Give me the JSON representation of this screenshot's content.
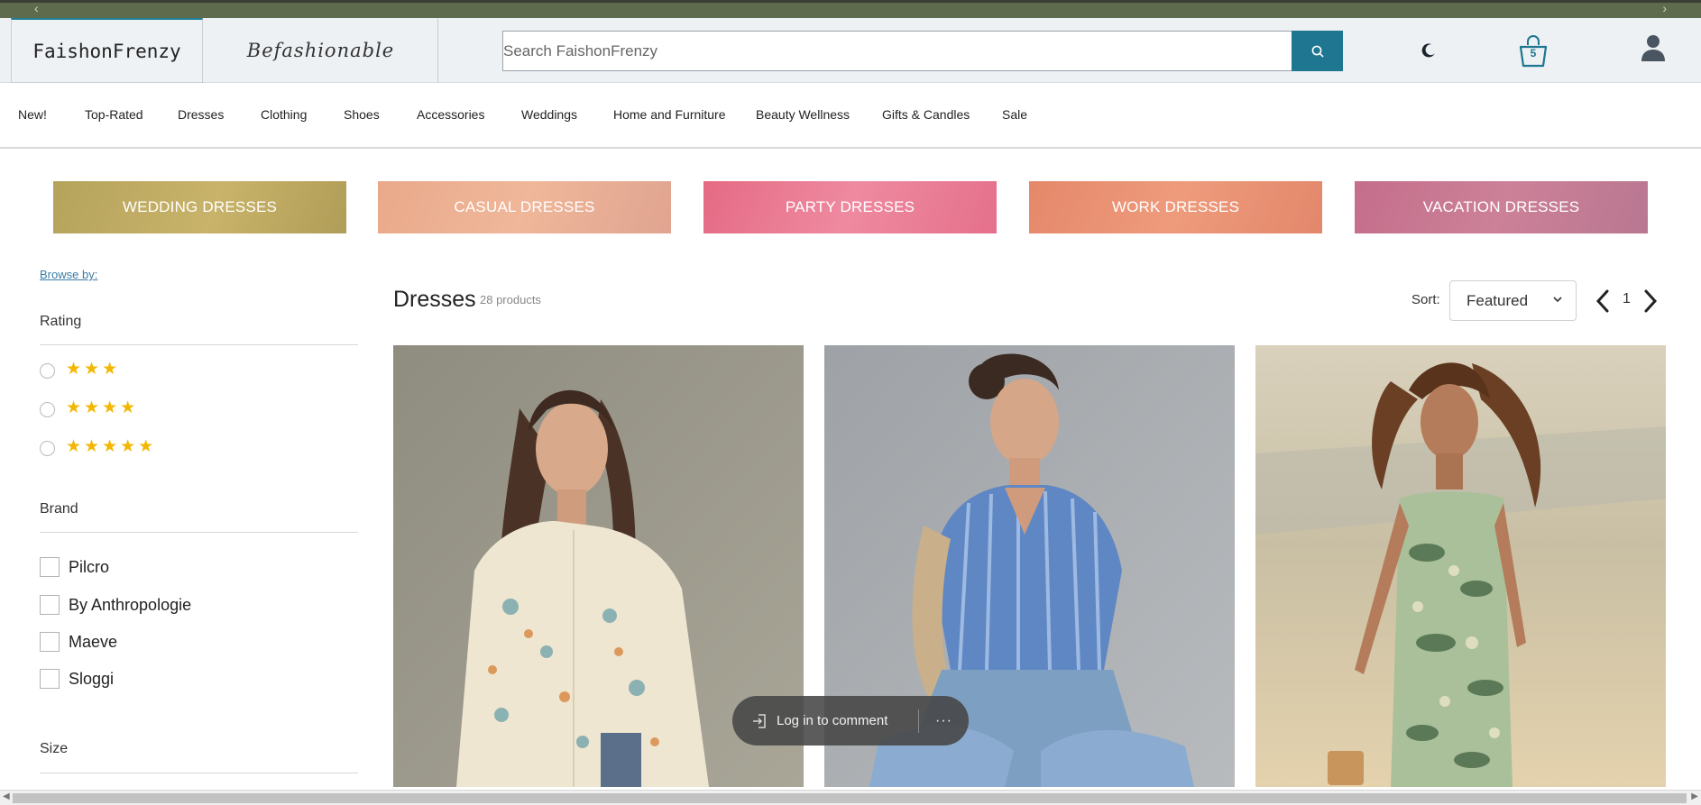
{
  "header": {
    "brand_active": "FaishonFrenzy",
    "brand_alt": "Befashionable",
    "search_placeholder": "Search FaishonFrenzy",
    "cart_count": "5"
  },
  "nav": {
    "items": [
      "New!",
      "Top-Rated",
      "Dresses",
      "Clothing",
      "Shoes",
      "Accessories",
      "Weddings",
      "Home and Furniture",
      "Beauty Wellness",
      "Gifts & Candles",
      "Sale"
    ]
  },
  "categories": [
    {
      "label": "WEDDING DRESSES",
      "color": "#b8a55e"
    },
    {
      "label": "CASUAL DRESSES",
      "color": "#eaa98e"
    },
    {
      "label": "PARTY DRESSES",
      "color": "#e8728a"
    },
    {
      "label": "WORK DRESSES",
      "color": "#e78c6e"
    },
    {
      "label": "VACATION DRESSES",
      "color": "#c77690"
    }
  ],
  "sidebar": {
    "browse_label": "Browse by:",
    "rating_title": "Rating",
    "ratings": [
      {
        "stars": "★★★",
        "value": 3
      },
      {
        "stars": "★★★★",
        "value": 4
      },
      {
        "stars": "★★★★★",
        "value": 5
      }
    ],
    "brand_title": "Brand",
    "brands": [
      "Pilcro",
      "By Anthropologie",
      "Maeve",
      "Sloggi"
    ],
    "size_title": "Size"
  },
  "results": {
    "title": "Dresses",
    "count": "28 products",
    "sort_label": "Sort:",
    "sort_value": "Featured",
    "page": "1"
  },
  "products": [
    {
      "image": "model-floral-shirt"
    },
    {
      "image": "model-blue-striped-top"
    },
    {
      "image": "model-floral-dress-beach"
    }
  ],
  "overlay": {
    "login_label": "Log in to comment",
    "more_label": "···"
  },
  "colors": {
    "accent": "#1e7690",
    "star": "#f2b705",
    "topbar": "#5f6b4d"
  }
}
